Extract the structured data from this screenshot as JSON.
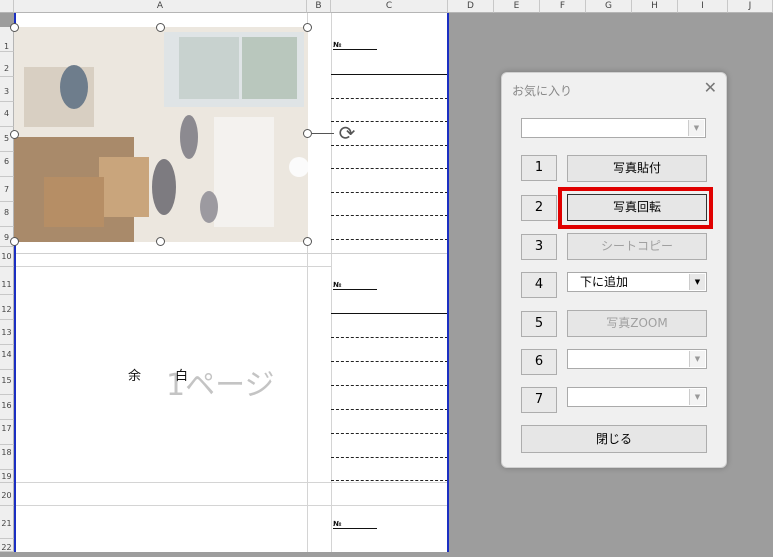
{
  "columns": [
    "A",
    "B",
    "C",
    "D",
    "E",
    "F",
    "G",
    "H",
    "I",
    "J"
  ],
  "rows": [
    "1",
    "2",
    "3",
    "4",
    "5",
    "6",
    "7",
    "8",
    "9",
    "10",
    "11",
    "12",
    "13",
    "14",
    "15",
    "16",
    "17",
    "18",
    "19",
    "20",
    "21",
    "22"
  ],
  "sheet": {
    "no_label": "№",
    "margin_text": [
      "余",
      "白"
    ],
    "page_watermark": "1ページ"
  },
  "dialog": {
    "title": "お気に入り",
    "close_glyph": "✕",
    "top_combo_value": "",
    "buttons": [
      {
        "num": "1",
        "label": "写真貼付",
        "enabled": true
      },
      {
        "num": "2",
        "label": "写真回転",
        "enabled": true
      },
      {
        "num": "3",
        "label": "シートコピー",
        "enabled": false
      },
      {
        "num": "4",
        "label": "下に追加",
        "type": "combo"
      },
      {
        "num": "5",
        "label": "写真ZOOM",
        "enabled": false
      },
      {
        "num": "6",
        "label": "",
        "type": "combo"
      },
      {
        "num": "7",
        "label": "",
        "type": "combo"
      }
    ],
    "close_label": "閉じる"
  },
  "colors": {
    "highlight": "#e00000",
    "page_border": "#1b2fc2"
  }
}
